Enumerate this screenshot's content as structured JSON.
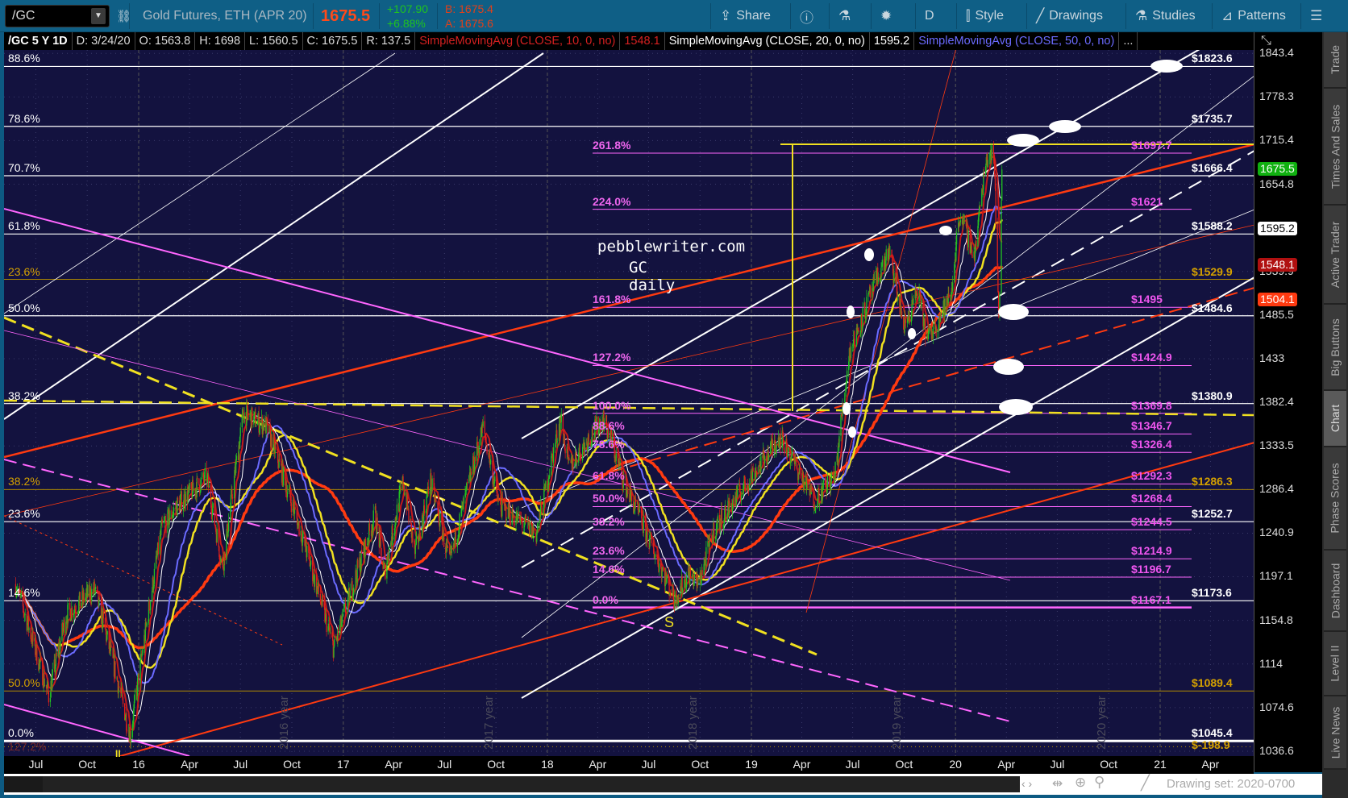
{
  "toolbar": {
    "symbol": "/GC",
    "description": "Gold Futures, ETH (APR 20)",
    "last": "1675.5",
    "change": "+107.90",
    "change_pct": "+6.88%",
    "bid": "B: 1675.4",
    "ask": "A: 1675.6",
    "buttons": [
      {
        "label": "Share",
        "icon": "share-icon"
      },
      {
        "label": "",
        "icon": "info-icon"
      },
      {
        "label": "",
        "icon": "flask-icon"
      },
      {
        "label": "",
        "icon": "gear-icon"
      },
      {
        "label": "D",
        "icon": ""
      },
      {
        "label": "Style",
        "icon": "candle-icon"
      },
      {
        "label": "Drawings",
        "icon": "pencil-icon"
      },
      {
        "label": "Studies",
        "icon": "flask-icon"
      },
      {
        "label": "Patterns",
        "icon": "pattern-icon"
      },
      {
        "label": "",
        "icon": "menu-icon"
      }
    ]
  },
  "infobar": {
    "title": "/GC 5 Y 1D",
    "date": "D: 3/24/20",
    "open": "O: 1563.8",
    "high": "H: 1698",
    "low": "L: 1560.5",
    "close": "C: 1675.5",
    "range": "R: 137.5",
    "studies": [
      {
        "label": "SimpleMovingAvg (CLOSE, 10, 0, no)",
        "value": "1548.1",
        "color": "#d42020"
      },
      {
        "label": "SimpleMovingAvg (CLOSE, 20, 0, no)",
        "value": "1595.2",
        "color": "#ffffff"
      },
      {
        "label": "SimpleMovingAvg (CLOSE, 50, 0, no)",
        "value": "",
        "color": "#6b6bff"
      }
    ],
    "more": "..."
  },
  "watermark": {
    "line1": "pebblewriter.com",
    "line2": "GC daily"
  },
  "year_marks": [
    {
      "date": "2016-09-20",
      "label": "2016 year"
    },
    {
      "date": "2017-09-20",
      "label": "2017 year"
    },
    {
      "date": "2018-09-20",
      "label": "2018 year"
    },
    {
      "date": "2019-09-20",
      "label": "2019 year"
    },
    {
      "date": "2020-09-20",
      "label": "2020 year"
    }
  ],
  "sidebar": {
    "tabs": [
      "Trade",
      "Times And Sales",
      "Active Trader",
      "Big Buttons",
      "Chart",
      "Phase Scores",
      "Dashboard",
      "Level II",
      "Live News"
    ],
    "active": "Chart"
  },
  "bottom": {
    "drawing_set": "Drawing set: 2020-0700"
  },
  "chart_data": {
    "type": "candlestick",
    "scale": "log",
    "symbol": "/GC",
    "period": "5 Y",
    "aggregation": "1D",
    "price_axis": {
      "ticks": [
        1843.4,
        1778.3,
        1715.4,
        1654.8,
        1539.9,
        1485.5,
        1433,
        1382.4,
        1333.5,
        1286.4,
        1240.9,
        1197.1,
        1154.8,
        1114,
        1074.6,
        1036.6
      ],
      "range": [
        1036.6,
        1843.4
      ]
    },
    "price_tags": [
      {
        "value": "1675.5",
        "bg": "#10b010",
        "fg": "#ffffff"
      },
      {
        "value": "1595.2",
        "bg": "#ffffff",
        "fg": "#000000"
      },
      {
        "value": "1548.1",
        "bg": "#b01010",
        "fg": "#ffffff"
      },
      {
        "value": "1504.1",
        "bg": "#ff3a10",
        "fg": "#ffffff"
      }
    ],
    "date_ticks": [
      [
        "2015-07-01",
        "Jul"
      ],
      [
        "2015-10-01",
        "Oct"
      ],
      [
        "2016-01-01",
        "16"
      ],
      [
        "2016-04-01",
        "Apr"
      ],
      [
        "2016-07-01",
        "Jul"
      ],
      [
        "2016-10-01",
        "Oct"
      ],
      [
        "2017-01-01",
        "17"
      ],
      [
        "2017-04-01",
        "Apr"
      ],
      [
        "2017-07-01",
        "Jul"
      ],
      [
        "2017-10-01",
        "Oct"
      ],
      [
        "2018-01-01",
        "18"
      ],
      [
        "2018-04-01",
        "Apr"
      ],
      [
        "2018-07-01",
        "Jul"
      ],
      [
        "2018-10-01",
        "Oct"
      ],
      [
        "2019-01-01",
        "19"
      ],
      [
        "2019-04-01",
        "Apr"
      ],
      [
        "2019-07-01",
        "Jul"
      ],
      [
        "2019-10-01",
        "Oct"
      ],
      [
        "2020-01-01",
        "20"
      ],
      [
        "2020-04-01",
        "Apr"
      ],
      [
        "2020-07-01",
        "Jul"
      ],
      [
        "2020-10-01",
        "Oct"
      ],
      [
        "2021-01-01",
        "21"
      ],
      [
        "2021-04-01",
        "Apr"
      ]
    ],
    "price_keypoints": [
      [
        "2015-05-26",
        1190
      ],
      [
        "2015-07-24",
        1085
      ],
      [
        "2015-08-24",
        1160
      ],
      [
        "2015-10-14",
        1185
      ],
      [
        "2015-12-17",
        1050
      ],
      [
        "2016-02-11",
        1245
      ],
      [
        "2016-03-10",
        1270
      ],
      [
        "2016-05-02",
        1300
      ],
      [
        "2016-05-30",
        1205
      ],
      [
        "2016-07-06",
        1370
      ],
      [
        "2016-08-17",
        1355
      ],
      [
        "2016-10-05",
        1265
      ],
      [
        "2016-12-15",
        1128
      ],
      [
        "2017-02-27",
        1260
      ],
      [
        "2017-03-15",
        1200
      ],
      [
        "2017-04-18",
        1295
      ],
      [
        "2017-05-09",
        1220
      ],
      [
        "2017-06-06",
        1295
      ],
      [
        "2017-07-10",
        1210
      ],
      [
        "2017-09-08",
        1355
      ],
      [
        "2017-10-06",
        1270
      ],
      [
        "2017-12-12",
        1240
      ],
      [
        "2018-01-25",
        1365
      ],
      [
        "2018-02-08",
        1310
      ],
      [
        "2018-04-11",
        1365
      ],
      [
        "2018-05-21",
        1290
      ],
      [
        "2018-08-16",
        1175
      ],
      [
        "2018-09-10",
        1200
      ],
      [
        "2018-09-28",
        1190
      ],
      [
        "2018-10-26",
        1245
      ],
      [
        "2019-01-30",
        1325
      ],
      [
        "2019-02-20",
        1345
      ],
      [
        "2019-04-23",
        1275
      ],
      [
        "2019-05-30",
        1300
      ],
      [
        "2019-06-25",
        1440
      ],
      [
        "2019-08-07",
        1520
      ],
      [
        "2019-09-04",
        1565
      ],
      [
        "2019-10-01",
        1470
      ],
      [
        "2019-10-25",
        1515
      ],
      [
        "2019-11-12",
        1455
      ],
      [
        "2019-12-24",
        1510
      ],
      [
        "2020-01-08",
        1615
      ],
      [
        "2020-02-04",
        1560
      ],
      [
        "2020-02-24",
        1690
      ],
      [
        "2020-03-09",
        1705
      ],
      [
        "2020-03-19",
        1475
      ],
      [
        "2020-03-24",
        1675.5
      ]
    ],
    "levels_white": [
      {
        "price": 1823.6,
        "label": "$1823.6",
        "pct": "88.6%"
      },
      {
        "price": 1735.7,
        "label": "$1735.7",
        "pct": "78.6%"
      },
      {
        "price": 1666.4,
        "label": "$1666.4",
        "pct": "70.7%"
      },
      {
        "price": 1588.2,
        "label": "$1588.2",
        "pct": "61.8%"
      },
      {
        "price": 1484.6,
        "label": "$1484.6",
        "pct": "50.0%"
      },
      {
        "price": 1380.9,
        "label": "$1380.9",
        "pct": "38.2%"
      },
      {
        "price": 1252.7,
        "label": "$1252.7",
        "pct": "23.6%"
      },
      {
        "price": 1173.6,
        "label": "$1173.6",
        "pct": "14.6%"
      },
      {
        "price": 1045.4,
        "label": "$1045.4",
        "pct": "0.0%"
      }
    ],
    "levels_gold": [
      {
        "price": 1529.9,
        "label": "$1529.9",
        "pct": "23.6%"
      },
      {
        "price": 1286.3,
        "label": "$1286.3",
        "pct": "38.2%"
      },
      {
        "price": 1089.4,
        "label": "$1089.4",
        "pct": "50.0%"
      },
      {
        "price": 1040.5,
        "label": "$-198.9",
        "pct": "127.2%"
      }
    ],
    "levels_fib": [
      {
        "price": 1697.7,
        "label": "$1697.7",
        "pct": "261.8%"
      },
      {
        "price": 1621,
        "label": "$1621",
        "pct": "224.0%"
      },
      {
        "price": 1495,
        "label": "$1495",
        "pct": "161.8%"
      },
      {
        "price": 1424.9,
        "label": "$1424.9",
        "pct": "127.2%"
      },
      {
        "price": 1369.8,
        "label": "$1369.8",
        "pct": "100.0%"
      },
      {
        "price": 1346.7,
        "label": "$1346.7",
        "pct": "88.6%"
      },
      {
        "price": 1326.4,
        "label": "$1326.4",
        "pct": "78.6%"
      },
      {
        "price": 1292.3,
        "label": "$1292.3",
        "pct": "61.8%"
      },
      {
        "price": 1268.4,
        "label": "$1268.4",
        "pct": "50.0%"
      },
      {
        "price": 1244.5,
        "label": "$1244.5",
        "pct": "38.2%"
      },
      {
        "price": 1214.9,
        "label": "$1214.9",
        "pct": "23.6%"
      },
      {
        "price": 1196.7,
        "label": "$1196.7",
        "pct": "14.6%"
      },
      {
        "price": 1167.1,
        "label": "$1167.1",
        "pct": "0.0%"
      }
    ],
    "markers": [
      {
        "label": "S"
      },
      {
        "label": "II"
      }
    ],
    "colors": {
      "up": "#22c322",
      "down": "#e0201a",
      "sma10": "#c41a1a",
      "sma20": "#ffffff",
      "sma50": "#6b6bff",
      "yellow_ma": "#f0e020",
      "orange_ma": "#ff3a10",
      "fib": "#ff66ff",
      "gold": "#d4a000"
    }
  }
}
